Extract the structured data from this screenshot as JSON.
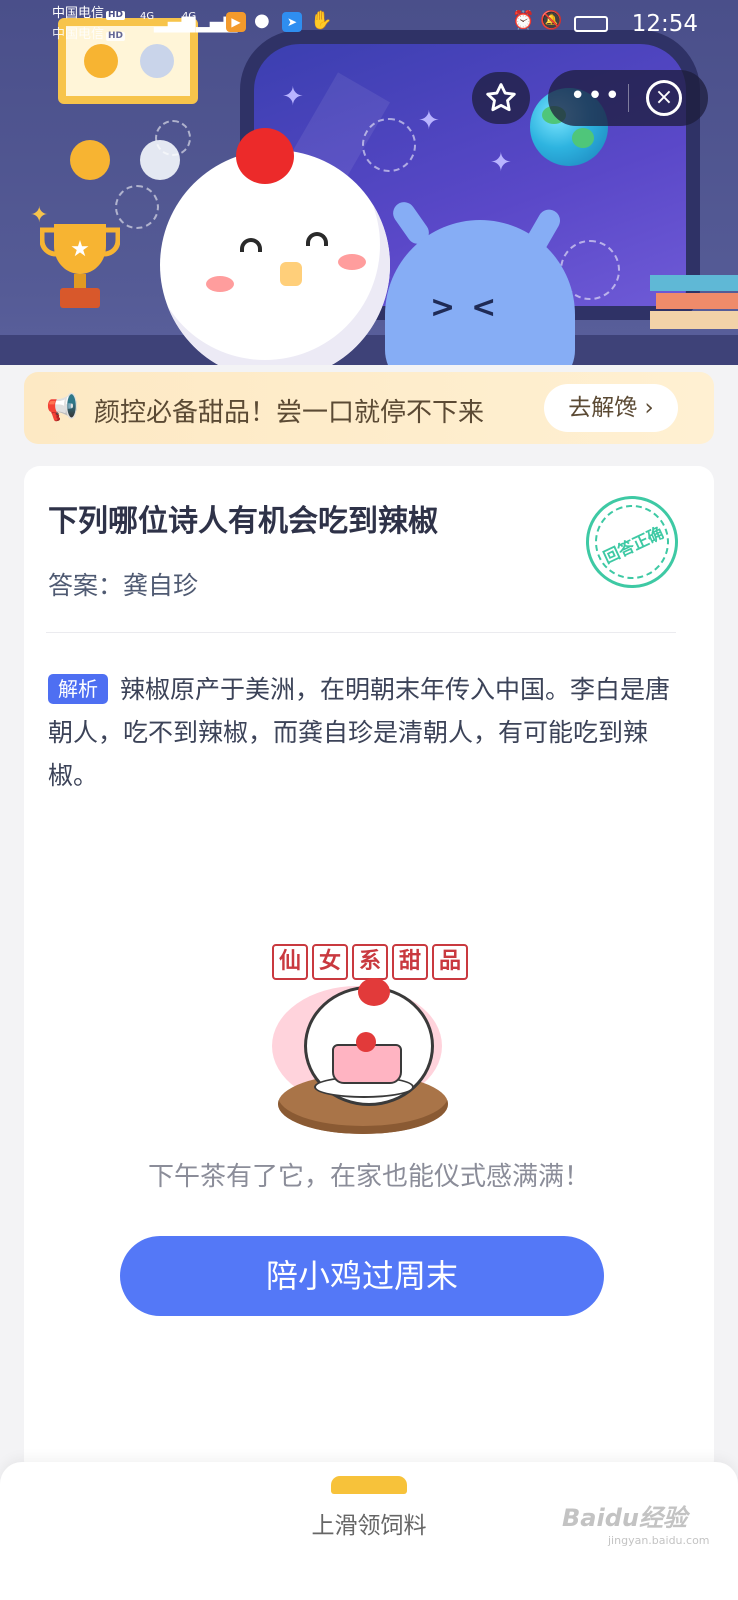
{
  "status_bar": {
    "carrier_1": "中国电信",
    "carrier_2": "中国电信",
    "hd_1": "HD",
    "hd_2": "HD",
    "network": "4G",
    "time": "12:54"
  },
  "notice": {
    "text": "颜控必备甜品！尝一口就停不下来",
    "button": "去解馋 ›"
  },
  "question": {
    "title": "下列哪位诗人有机会吃到辣椒",
    "answer": "答案：龚自珍",
    "stamp": "回答正确",
    "analysis_tag": "解析",
    "analysis_text": "辣椒原产于美洲，在明朝末年传入中国。李白是唐朝人，吃不到辣椒，而龚自珍是清朝人，有可能吃到辣椒。"
  },
  "promo": {
    "title_chars": [
      "仙",
      "女",
      "系",
      "甜",
      "品"
    ],
    "description": "下午茶有了它，在家也能仪式感满满！",
    "button": "陪小鸡过周末"
  },
  "bottom_sheet": {
    "label": "上滑领饲料"
  },
  "watermark": {
    "main": "Baidu经验",
    "sub": "jingyan.baidu.com"
  },
  "colors": {
    "accent": "#5478f7",
    "stamp": "#3ec9a4",
    "notice_bg": "#fde9c4",
    "banner": "#4a4f8a"
  }
}
